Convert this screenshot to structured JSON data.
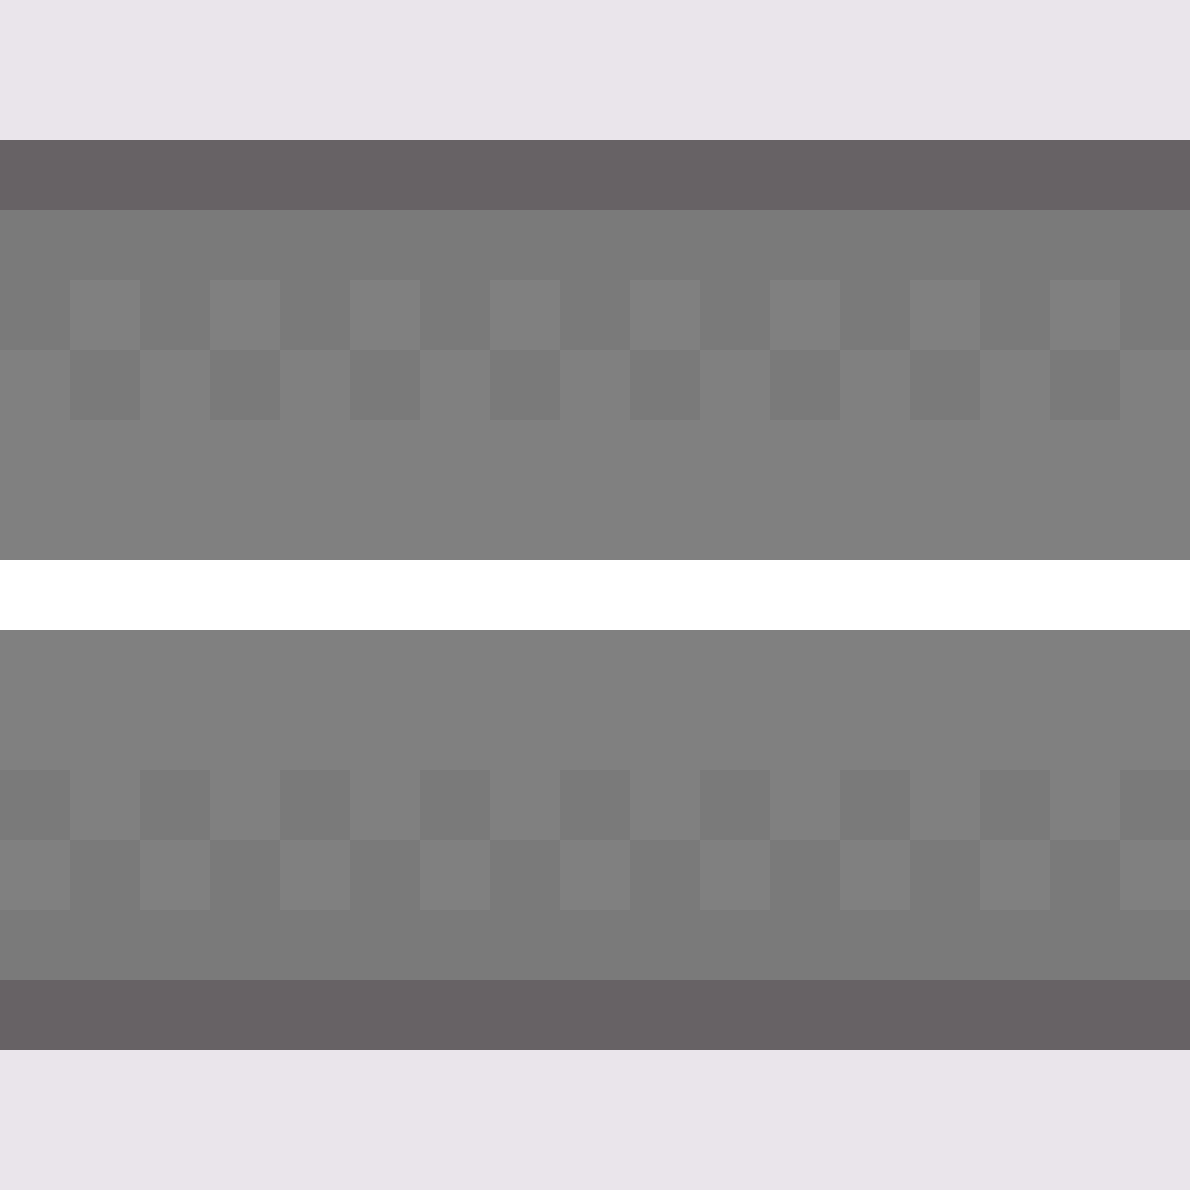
{
  "game": {
    "view": "top-down-road-tiles",
    "palette": {
      "background": "#eae5eb",
      "curb": "#676265",
      "asphalt_dark": "#7a7a7a",
      "asphalt_light": "#808080",
      "median": "#ffffff"
    },
    "checker_columns": 17,
    "upper_checker_rows": [
      "dark-light",
      "light-dark"
    ],
    "lower_checker_rows": [
      "dark-light",
      "light-dark"
    ]
  }
}
